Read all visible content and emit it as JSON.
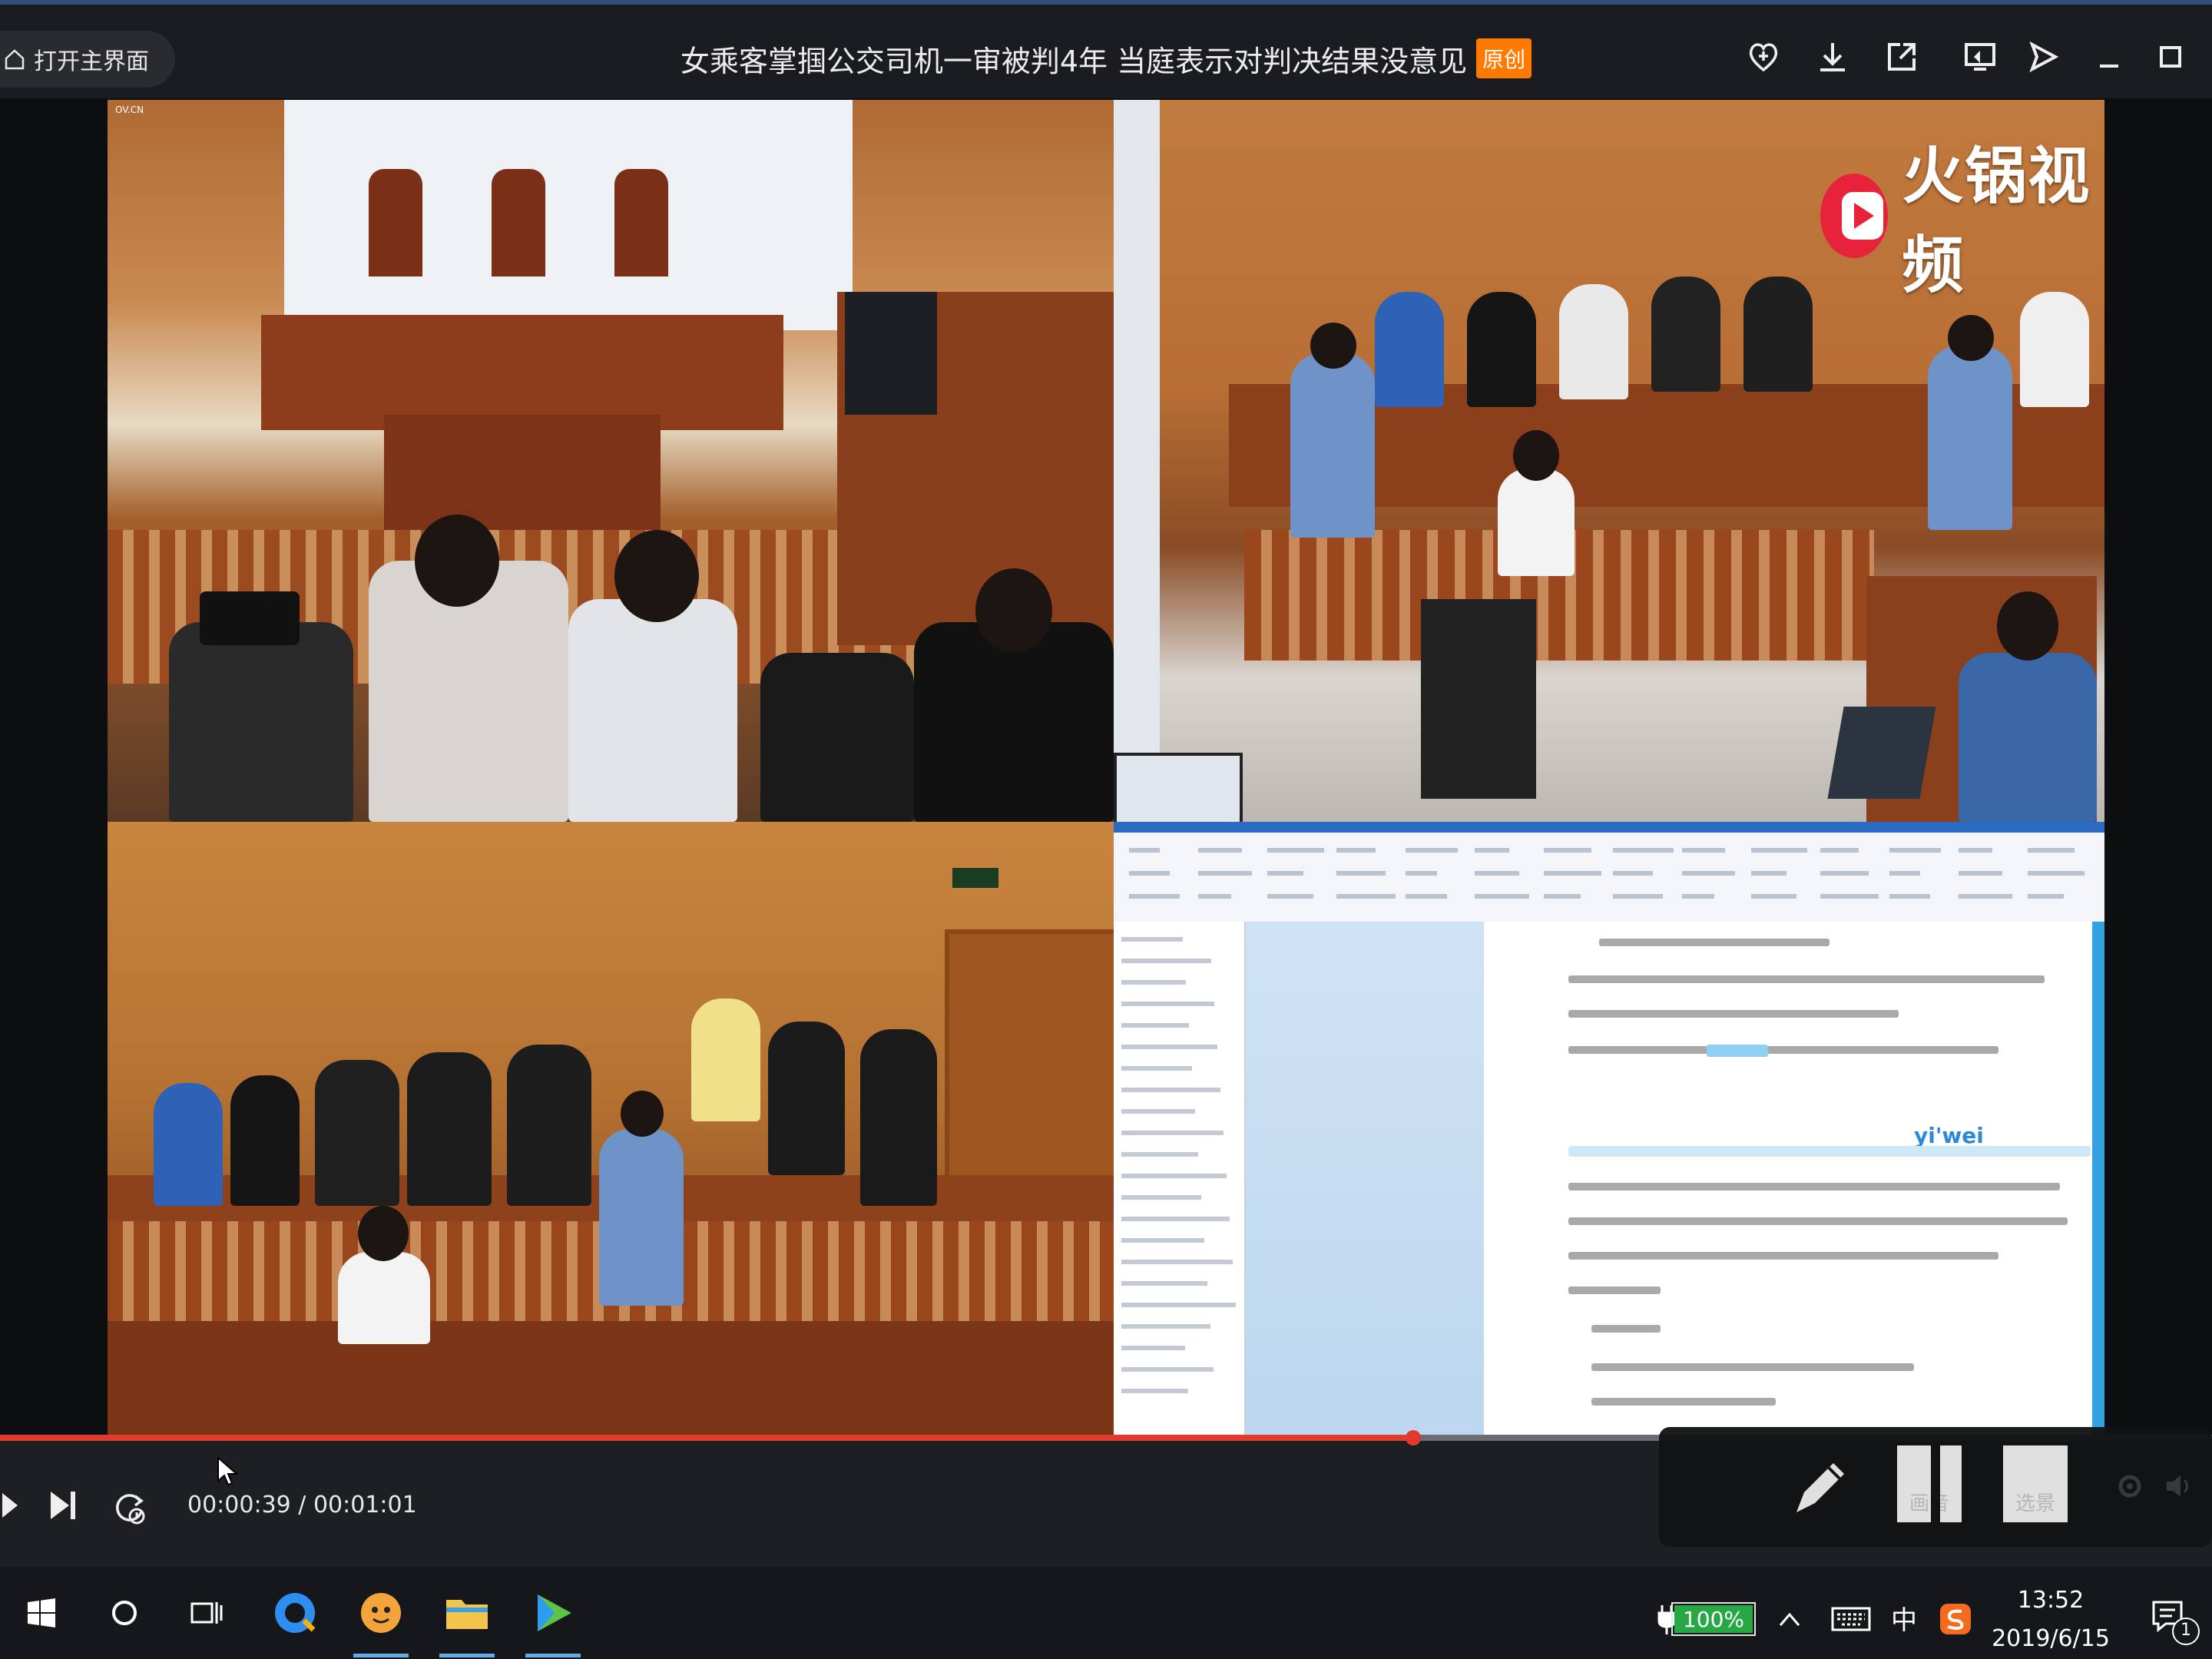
{
  "titlebar": {
    "home_label": "打开主界面",
    "title": "女乘客掌掴公交司机一审被判4年 当庭表示对判决结果没意见",
    "badge": "原创",
    "icons": [
      "heart-plus-icon",
      "download-icon",
      "share-out-icon",
      "screen-cast-icon",
      "send-icon",
      "minimize-icon",
      "maximize-icon"
    ]
  },
  "video": {
    "watermark_text": "火锅视频",
    "top_left_tag": "OV.CN",
    "ime_candidate": "yi'wei"
  },
  "player": {
    "progress_fraction": 0.639,
    "time_current": "00:00:39",
    "time_separator": " / ",
    "time_total": "00:01:01",
    "float_panel": {
      "pen_icon": "pencil-icon",
      "btn1_label": "画音",
      "btn2_label": "选景"
    },
    "accent_color": "#e23a2e"
  },
  "taskbar": {
    "items": [
      "windows-start",
      "cortana",
      "task-view",
      "qq-browser",
      "qq-avatar",
      "file-explorer",
      "media-player"
    ],
    "battery_percent": "100%",
    "battery_level": 1.0,
    "ime": "中",
    "time": "13:52",
    "date": "2019/6/15",
    "notification_count": "1"
  }
}
